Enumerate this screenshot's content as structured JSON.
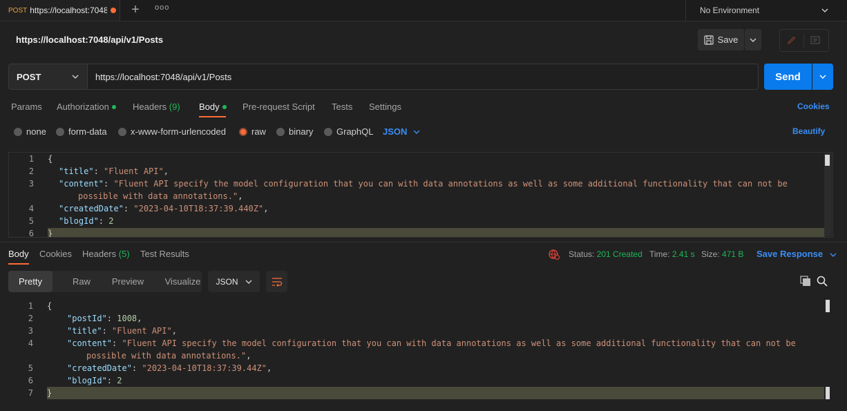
{
  "tab": {
    "method": "POST",
    "url": "https://localhost:7048",
    "plus": "+",
    "more": "ooo"
  },
  "environment": {
    "label": "No Environment"
  },
  "request": {
    "title": "https://localhost:7048/api/v1/Posts",
    "save_label": "Save",
    "method": "POST",
    "url": "https://localhost:7048/api/v1/Posts",
    "send_label": "Send"
  },
  "request_tabs": [
    {
      "label": "Params"
    },
    {
      "label": "Authorization"
    },
    {
      "label": "Headers",
      "count": "(9)"
    },
    {
      "label": "Body"
    },
    {
      "label": "Pre-request Script"
    },
    {
      "label": "Tests"
    },
    {
      "label": "Settings"
    }
  ],
  "cookies_label": "Cookies",
  "body_types": [
    {
      "label": "none",
      "selected": false
    },
    {
      "label": "form-data",
      "selected": false
    },
    {
      "label": "x-www-form-urlencoded",
      "selected": false
    },
    {
      "label": "raw",
      "selected": true
    },
    {
      "label": "binary",
      "selected": false
    },
    {
      "label": "GraphQL",
      "selected": false
    }
  ],
  "body_format": "JSON",
  "beautify_label": "Beautify",
  "request_body_lines": [
    {
      "n": "1",
      "text": "{"
    },
    {
      "n": "2",
      "key": "\"title\"",
      "val": "\"Fluent API\"",
      "end": ","
    },
    {
      "n": "3",
      "key": "\"content\"",
      "val": "\"Fluent API specify the model configuration that you can with data annotations as well as some additional functionality that can not be",
      "cont": "possible with data annotations.\"",
      "end": ","
    },
    {
      "n": "4",
      "key": "\"createdDate\"",
      "val": "\"2023-04-10T18:37:39.440Z\"",
      "end": ","
    },
    {
      "n": "5",
      "key": "\"blogId\"",
      "num": "2",
      "end": ""
    },
    {
      "n": "6",
      "text": "}"
    }
  ],
  "response_tabs": [
    {
      "label": "Body"
    },
    {
      "label": "Cookies"
    },
    {
      "label": "Headers",
      "count": "(5)"
    },
    {
      "label": "Test Results"
    }
  ],
  "response_status": {
    "status_label": "Status:",
    "status_value": "201 Created",
    "time_label": "Time:",
    "time_value": "2.41 s",
    "size_label": "Size:",
    "size_value": "471 B"
  },
  "save_response_label": "Save Response",
  "response_formats": [
    "Pretty",
    "Raw",
    "Preview",
    "Visualize"
  ],
  "response_format_type": "JSON",
  "response_body_lines": [
    {
      "n": "1",
      "text": "{"
    },
    {
      "n": "2",
      "key": "\"postId\"",
      "num": "1008",
      "end": ","
    },
    {
      "n": "3",
      "key": "\"title\"",
      "val": "\"Fluent API\"",
      "end": ","
    },
    {
      "n": "4",
      "key": "\"content\"",
      "val": "\"Fluent API specify the model configuration that you can with data annotations as well as some additional functionality that can not be",
      "cont": "possible with data annotations.\"",
      "end": ","
    },
    {
      "n": "5",
      "key": "\"createdDate\"",
      "val": "\"2023-04-10T18:37:39.44Z\"",
      "end": ","
    },
    {
      "n": "6",
      "key": "\"blogId\"",
      "num": "2",
      "end": ""
    },
    {
      "n": "7",
      "text": "}"
    }
  ],
  "colors": {
    "accent": "#ff6c37",
    "link": "#3a8ef6",
    "send": "#097bed",
    "success": "#1fb85a"
  }
}
